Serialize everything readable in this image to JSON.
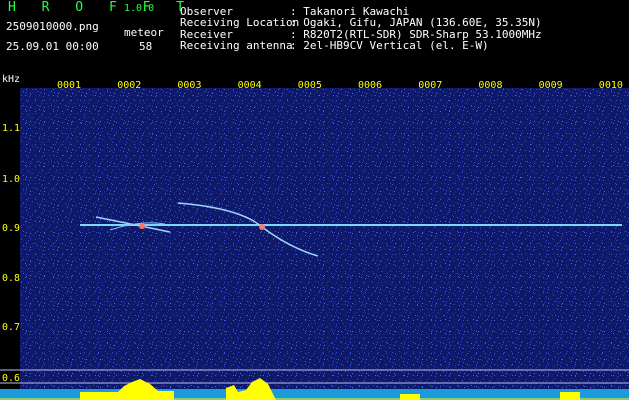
{
  "header": {
    "brand": "H R O F F T",
    "version": "1.0.0",
    "filename": "2509010000.png",
    "datetime": "25.09.01 00:00",
    "meteor_label": "meteor",
    "meteor_count": "58",
    "info": [
      {
        "label": "Observer",
        "value": ": Takanori Kawachi"
      },
      {
        "label": "Receiving Location",
        "value": ": Ogaki, Gifu, JAPAN (136.60E, 35.35N)"
      },
      {
        "label": "Receiver",
        "value": ": R820T2(RTL-SDR) SDR-Sharp 53.1000MHz"
      },
      {
        "label": "Receiving antenna",
        "value": ": 2el-HB9CV Vertical (el. E-W)"
      }
    ]
  },
  "spectrogram": {
    "y_unit": "kHz",
    "y_ticks": [
      "1.1",
      "1.0",
      "0.9",
      "0.8",
      "0.7",
      "0.6"
    ],
    "x_ticks": [
      "0001",
      "0002",
      "0003",
      "0004",
      "0005",
      "0006",
      "0007",
      "0008",
      "0009",
      "0010"
    ],
    "carrier_khz": 0.91,
    "colors": {
      "background": "#000000",
      "field": "#101a6e",
      "header_text": "#ffffff",
      "brand": "#22ff44",
      "ticks": "#ffff00",
      "signal": "#7ad8ff"
    }
  }
}
